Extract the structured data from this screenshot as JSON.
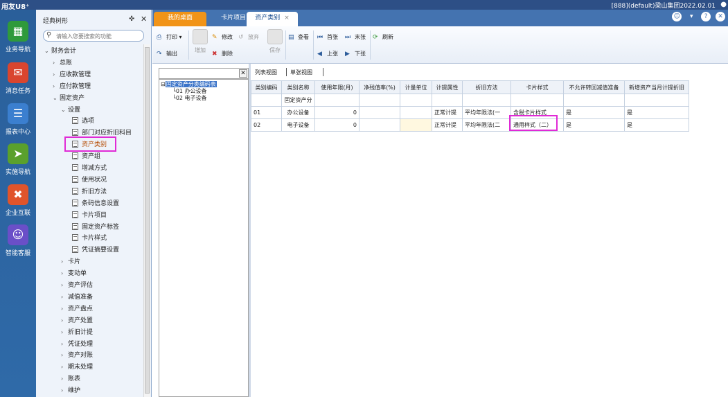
{
  "app": {
    "logo": "用友U8⁺",
    "titlebar_info": "[888](default)梁山集团2022.02.01",
    "user_icon": "user-icon"
  },
  "rail": {
    "items": [
      {
        "label": "业务导航",
        "icon": "business-nav-icon",
        "color": "#2f9a3b"
      },
      {
        "label": "消息任务",
        "icon": "message-task-icon",
        "color": "#d9452f"
      },
      {
        "label": "报表中心",
        "icon": "report-center-icon",
        "color": "#3b7fcf"
      },
      {
        "label": "实施导航",
        "icon": "implementation-nav-icon",
        "color": "#5aa02c"
      },
      {
        "label": "企业互联",
        "icon": "enterprise-connect-icon",
        "color": "#e0542b"
      },
      {
        "label": "智能客服",
        "icon": "smart-service-icon",
        "color": "#6a4fc8"
      }
    ]
  },
  "tree_panel": {
    "title": "经典树形",
    "search_placeholder": "请输入您要搜索的功能",
    "nodes": [
      {
        "label": "财务会计",
        "arrow": "⌄",
        "level": 0
      },
      {
        "label": "总账",
        "arrow": "›",
        "level": 1
      },
      {
        "label": "应收款管理",
        "arrow": "›",
        "level": 1
      },
      {
        "label": "应付款管理",
        "arrow": "›",
        "level": 1
      },
      {
        "label": "固定资产",
        "arrow": "⌄",
        "level": 1
      },
      {
        "label": "设置",
        "arrow": "⌄",
        "level": 2
      },
      {
        "label": "选项",
        "doc": true,
        "level": 3
      },
      {
        "label": "部门对应折旧科目",
        "doc": true,
        "level": 3
      },
      {
        "label": "资产类别",
        "doc": true,
        "level": 3,
        "active": true
      },
      {
        "label": "资产组",
        "doc": true,
        "level": 3
      },
      {
        "label": "增减方式",
        "doc": true,
        "level": 3
      },
      {
        "label": "使用状况",
        "doc": true,
        "level": 3
      },
      {
        "label": "折旧方法",
        "doc": true,
        "level": 3
      },
      {
        "label": "条码信息设置",
        "doc": true,
        "level": 3
      },
      {
        "label": "卡片项目",
        "doc": true,
        "level": 3
      },
      {
        "label": "固定资产标签",
        "doc": true,
        "level": 3
      },
      {
        "label": "卡片样式",
        "doc": true,
        "level": 3
      },
      {
        "label": "凭证摘要设置",
        "doc": true,
        "level": 3
      },
      {
        "label": "卡片",
        "arrow": "›",
        "level": 2
      },
      {
        "label": "变动单",
        "arrow": "›",
        "level": 2
      },
      {
        "label": "资产评估",
        "arrow": "›",
        "level": 2
      },
      {
        "label": "减值准备",
        "arrow": "›",
        "level": 2
      },
      {
        "label": "资产盘点",
        "arrow": "›",
        "level": 2
      },
      {
        "label": "资产处置",
        "arrow": "›",
        "level": 2
      },
      {
        "label": "折旧计提",
        "arrow": "›",
        "level": 2
      },
      {
        "label": "凭证处理",
        "arrow": "›",
        "level": 2
      },
      {
        "label": "资产对账",
        "arrow": "›",
        "level": 2
      },
      {
        "label": "期末处理",
        "arrow": "›",
        "level": 2
      },
      {
        "label": "账表",
        "arrow": "›",
        "level": 2
      },
      {
        "label": "维护",
        "arrow": "›",
        "level": 2
      }
    ]
  },
  "tabs": {
    "home": "我的桌面",
    "card_items": "卡片项目",
    "active": "资产类别",
    "close": "×"
  },
  "toolbar": {
    "print": "打印",
    "output": "输出",
    "add": "增加",
    "modify": "修改",
    "delete": "删除",
    "abandon": "放弃",
    "save": "保存",
    "view": "查看",
    "first": "首张",
    "last": "末张",
    "prev": "上张",
    "next": "下张",
    "refresh": "刷新"
  },
  "class_tree": {
    "root": "固定资产分类编码表",
    "children": [
      "01 办公设备",
      "02 电子设备"
    ]
  },
  "view_tabs": {
    "list": "列表视图",
    "single": "单张视图"
  },
  "grid": {
    "headers": [
      "类别编码",
      "类别名称",
      "使用年限(月)",
      "净残值率(%)",
      "计量单位",
      "计提属性",
      "折旧方法",
      "卡片样式",
      "不允许转回减值准备",
      "新增资产当月计提折旧"
    ],
    "root_name": "固定资产分",
    "rows": [
      [
        "01",
        "办公设备",
        "0",
        "",
        "",
        "正常计提",
        "平均年限法(一",
        "含税卡片样式",
        "是",
        "是"
      ],
      [
        "02",
        "电子设备",
        "0",
        "",
        "",
        "正常计提",
        "平均年限法(二",
        "通用样式（二）",
        "是",
        "是"
      ]
    ]
  }
}
